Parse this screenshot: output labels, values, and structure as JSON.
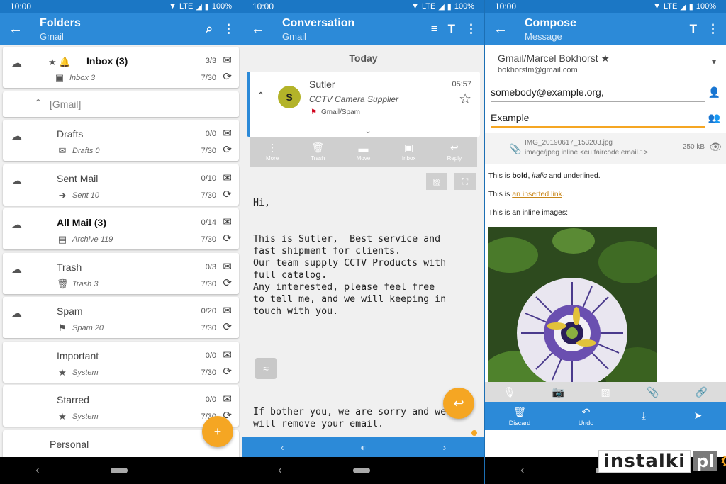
{
  "status": {
    "time": "10:00",
    "network": "LTE",
    "battery": "100%"
  },
  "folders_screen": {
    "title": "Folders",
    "subtitle": "Gmail",
    "items": [
      {
        "name": "Inbox (3)",
        "bold": true,
        "sub": "Inbox 3",
        "count": "3/3",
        "date": "7/30",
        "sub_icon": "inbox-icon",
        "pre_icons": "★ 🔔"
      },
      {
        "group": "[Gmail]"
      },
      {
        "name": "Drafts",
        "sub": "Drafts 0",
        "count": "0/0",
        "date": "7/30",
        "sub_icon": "drafts-icon"
      },
      {
        "name": "Sent Mail",
        "sub": "Sent 10",
        "count": "0/10",
        "date": "7/30",
        "sub_icon": "send-icon"
      },
      {
        "name": "All Mail (3)",
        "bold": true,
        "sub": "Archive 119",
        "count": "0/14",
        "date": "7/30",
        "sub_icon": "archive-icon"
      },
      {
        "name": "Trash",
        "sub": "Trash 3",
        "count": "0/3",
        "date": "7/30",
        "sub_icon": "trash-icon"
      },
      {
        "name": "Spam",
        "sub": "Spam 20",
        "count": "0/20",
        "date": "7/30",
        "sub_icon": "flag-icon"
      },
      {
        "name": "Important",
        "sub": "System",
        "count": "0/0",
        "date": "7/30",
        "sub_icon": "system-folder-icon"
      },
      {
        "name": "Starred",
        "sub": "System",
        "count": "0/0",
        "date": "7/30",
        "sub_icon": "system-folder-icon"
      },
      {
        "name": "Personal",
        "sub": "",
        "count": "",
        "date": "",
        "sub_icon": "folder-icon"
      }
    ]
  },
  "conversation_screen": {
    "title": "Conversation",
    "subtitle": "Gmail",
    "day": "Today",
    "sender": "Sutler",
    "avatar_letter": "S",
    "subject": "CCTV Camera Supplier",
    "folder": "Gmail/Spam",
    "time": "05:57",
    "toolbar": [
      "More",
      "Trash",
      "Move",
      "Inbox",
      "Reply"
    ],
    "body_top": "Hi,\n\n\nThis is Sutler,  Best service and\nfast shipment for clients.\nOur team supply CCTV Products with\nfull catalog.\nAny interested, please feel free\nto tell me, and we will keeping in\ntouch with you.",
    "body_bottom": "If bother you, we are sorry and we\nwill remove your email."
  },
  "compose_screen": {
    "title": "Compose",
    "subtitle": "Message",
    "identity": "Gmail/Marcel Bokhorst ★",
    "identity_email": "bokhorstm@gmail.com",
    "to": "somebody@example.org,",
    "subject": "Example",
    "attachment_name": "IMG_20190617_153203.jpg",
    "attachment_type": "image/jpeg inline <eu.faircode.email.1>",
    "attachment_size": "250 kB",
    "line1_prefix": "This is ",
    "line1_bold": "bold",
    "line1_mid": ", ",
    "line1_italic": "italic",
    "line1_and": " and ",
    "line1_underline": "underlined",
    "line1_end": ".",
    "line2_prefix": "This is ",
    "line2_link": "an inserted link",
    "line2_end": ".",
    "line3": "This is an inline images:",
    "actions": [
      "Discard",
      "Undo",
      "",
      ""
    ]
  },
  "watermark": {
    "text": "instalki",
    "suffix": "pl"
  },
  "colors": {
    "appbar": "#2c8ad8",
    "statusbar": "#1b77c5",
    "accent": "#f5a623"
  }
}
